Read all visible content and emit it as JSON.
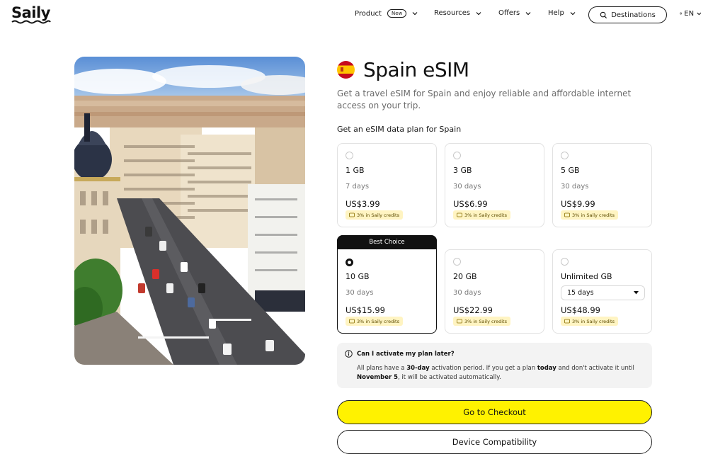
{
  "brand": {
    "logo_text": "Saily"
  },
  "nav": {
    "product": "Product",
    "product_badge": "New",
    "resources": "Resources",
    "offers": "Offers",
    "help": "Help",
    "destinations": "Destinations",
    "language": "EN"
  },
  "hero": {
    "alt": "Madrid street aerial view"
  },
  "page": {
    "title": "Spain eSIM",
    "subtitle": "Get a travel eSIM for Spain and enjoy reliable and affordable internet access on your trip.",
    "plans_heading": "Get an eSIM data plan for Spain"
  },
  "plans": [
    {
      "data": "1 GB",
      "days": "7 days",
      "price": "US$3.99",
      "credits": "3% in Saily credits"
    },
    {
      "data": "3 GB",
      "days": "30 days",
      "price": "US$6.99",
      "credits": "3% in Saily credits"
    },
    {
      "data": "5 GB",
      "days": "30 days",
      "price": "US$9.99",
      "credits": "3% in Saily credits"
    },
    {
      "label": "Best Choice",
      "data": "10 GB",
      "days": "30 days",
      "price": "US$15.99",
      "credits": "3% in Saily credits",
      "selected": true
    },
    {
      "data": "20 GB",
      "days": "30 days",
      "price": "US$22.99",
      "credits": "3% in Saily credits"
    },
    {
      "data": "Unlimited GB",
      "days_select": "15 days",
      "price": "US$48.99",
      "credits": "3% in Saily credits"
    }
  ],
  "info": {
    "question": "Can I activate my plan later?",
    "answer_pre": "All plans have a ",
    "answer_b1": "30-day",
    "answer_mid": " activation period. If you get a plan ",
    "answer_b2": "today",
    "answer_mid2": " and don't activate it until ",
    "answer_b3": "November 5",
    "answer_post": ", it will be activated automatically."
  },
  "buttons": {
    "checkout": "Go to Checkout",
    "compatibility": "Device Compatibility"
  },
  "colors": {
    "accent": "#fff200",
    "credit_badge": "#fff4c2",
    "dark": "#111111"
  }
}
